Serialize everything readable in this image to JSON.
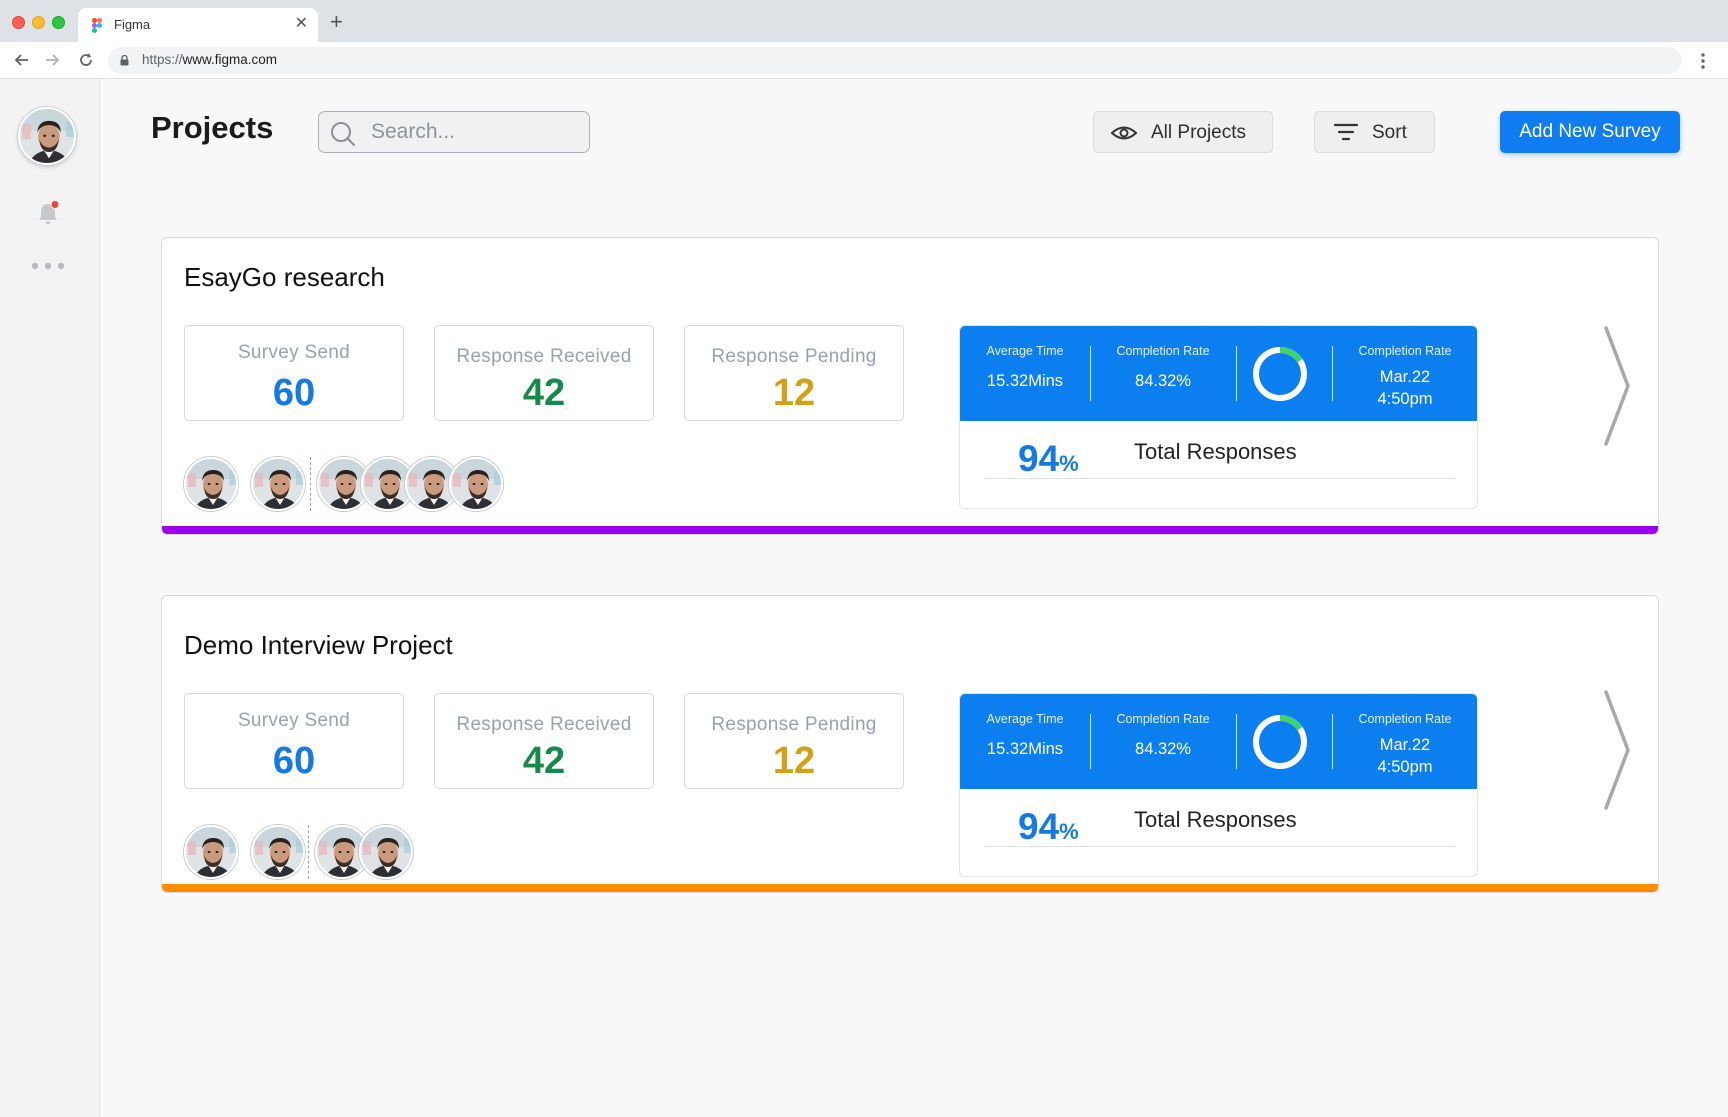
{
  "browser": {
    "tab_title": "Figma",
    "url_scheme": "https://",
    "url_host": "www.figma.com"
  },
  "sidebar": {
    "notification_dot_color": "#f4433a"
  },
  "header": {
    "title": "Projects",
    "search_placeholder": "Search...",
    "all_projects_label": "All Projects",
    "sort_label": "Sort",
    "add_survey_label": "Add New Survey",
    "accent": "#0f7cf2"
  },
  "projects": [
    {
      "title": "EsayGo research",
      "stats": [
        {
          "label": "Survey Send",
          "value": "60",
          "color": "#1479e3"
        },
        {
          "label": "Response Received",
          "value": "42",
          "color": "#168a4a"
        },
        {
          "label": "Response Pending",
          "value": "12",
          "color": "#d4a018"
        }
      ],
      "metrics": {
        "avg_time_label": "Average Time",
        "avg_time_value": "15.32Mins",
        "completion_label": "Completion Rate",
        "completion_value": "84.32%",
        "completion_fraction": 0.8432,
        "date_label": "Completion Rate",
        "date_line1": "Mar.22",
        "date_line2": "4:50pm",
        "percent": "94",
        "percent_sign": "%",
        "total_label": "Total Responses"
      },
      "avatars": 6,
      "bar_color": "#9b00ec"
    },
    {
      "title": "Demo Interview Project",
      "stats": [
        {
          "label": "Survey Send",
          "value": "60",
          "color": "#1479e3"
        },
        {
          "label": "Response Received",
          "value": "42",
          "color": "#168a4a"
        },
        {
          "label": "Response Pending",
          "value": "12",
          "color": "#d4a018"
        }
      ],
      "metrics": {
        "avg_time_label": "Average Time",
        "avg_time_value": "15.32Mins",
        "completion_label": "Completion Rate",
        "completion_value": "84.32%",
        "completion_fraction": 0.8432,
        "date_label": "Completion Rate",
        "date_line1": "Mar.22",
        "date_line2": "4:50pm",
        "percent": "94",
        "percent_sign": "%",
        "total_label": "Total Responses"
      },
      "avatars": 4,
      "bar_color": "#ff8c00"
    }
  ]
}
